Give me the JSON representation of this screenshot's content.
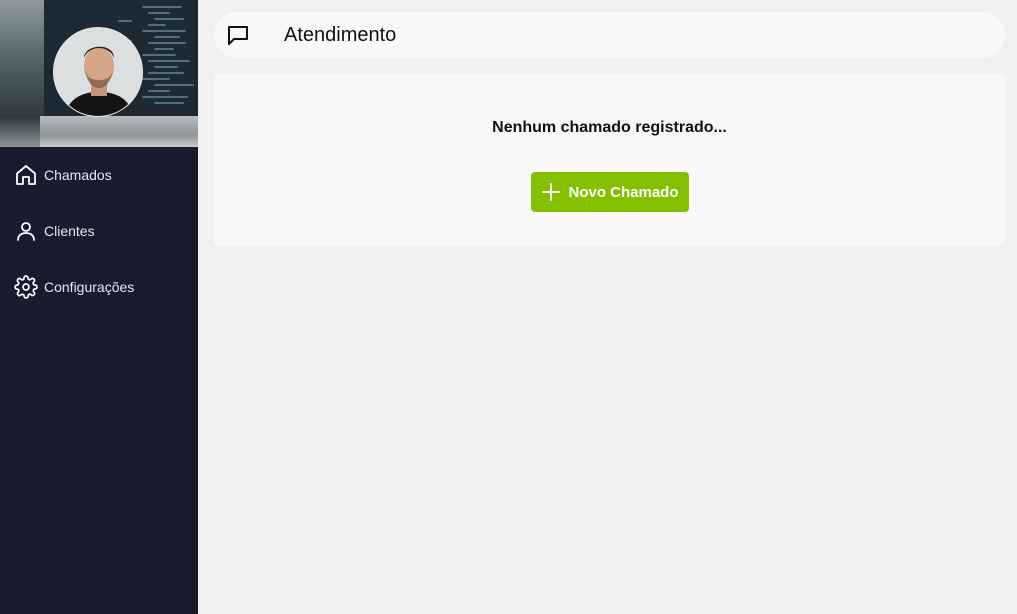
{
  "header": {
    "icon": "chat-bubble-icon",
    "title": "Atendimento"
  },
  "sidebar": {
    "avatar_icon": "user-avatar",
    "items": [
      {
        "label": "Chamados",
        "icon": "home-icon"
      },
      {
        "label": "Clientes",
        "icon": "user-icon"
      },
      {
        "label": "Configurações",
        "icon": "gear-icon"
      }
    ]
  },
  "main": {
    "empty_message": "Nenhum chamado registrado...",
    "new_button_label": "Novo Chamado",
    "new_button_icon": "plus-icon"
  },
  "colors": {
    "sidebar_bg": "#181c2e",
    "page_bg": "#f0f0f0",
    "accent_green": "#83c100"
  }
}
